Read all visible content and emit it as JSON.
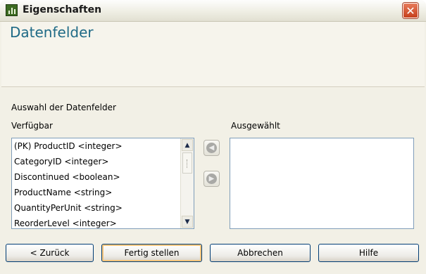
{
  "window": {
    "title": "Eigenschaften",
    "close_glyph": "✕"
  },
  "header": {
    "title": "Datenfelder"
  },
  "section": {
    "label": "Auswahl der Datenfelder"
  },
  "available": {
    "label": "Verfügbar",
    "items": [
      "(PK) ProductID <integer>",
      "CategoryID <integer>",
      "Discontinued <boolean>",
      "ProductName <string>",
      "QuantityPerUnit <string>",
      "ReorderLevel <integer>"
    ]
  },
  "selected": {
    "label": "Ausgewählt",
    "items": []
  },
  "move_buttons": {
    "left_icon": "arrow-left-icon",
    "right_icon": "arrow-right-icon",
    "left_glyph": "◀",
    "right_glyph": "▶"
  },
  "scrollbar": {
    "up_glyph": "▲",
    "down_glyph": "▼"
  },
  "buttons": {
    "back": "< Zurück",
    "finish": "Fertig stellen",
    "cancel": "Abbrechen",
    "help": "Hilfe"
  },
  "colors": {
    "header_title": "#1f6a86",
    "list_border": "#7f9db9",
    "close_button": "#c6401c"
  }
}
